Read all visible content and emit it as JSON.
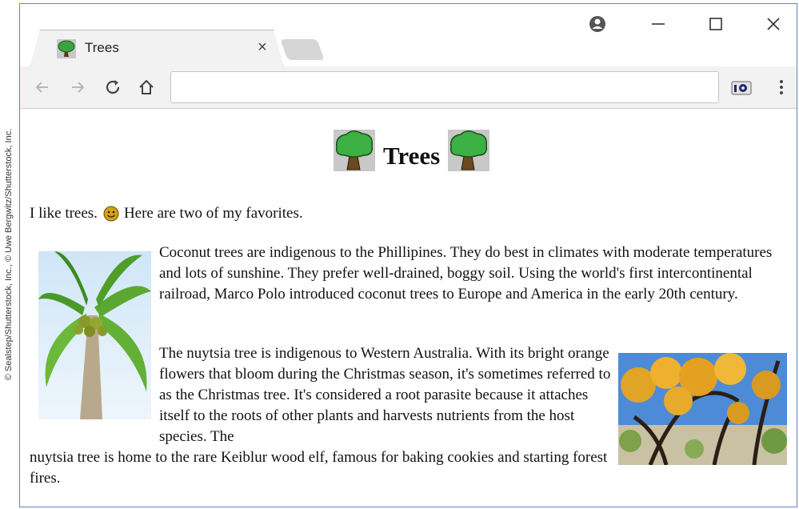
{
  "credit": "© Sealstep/Shutterstock, Inc., © Uwe Bergwitz/Shutterstock, Inc.",
  "browser": {
    "tab": {
      "title": "Trees",
      "close_glyph": "×",
      "icon": "tree-icon"
    },
    "window_controls": [
      "account-icon",
      "minimize-icon",
      "maximize-icon",
      "close-icon"
    ],
    "toolbar": {
      "buttons": [
        "back-arrow-icon",
        "forward-arrow-icon",
        "reload-icon",
        "home-icon"
      ],
      "address_value": "",
      "extension": "camera-extension-icon",
      "menu": "more-vertical-icon"
    }
  },
  "page": {
    "heading": "Trees",
    "intro_before": "I like trees.",
    "intro_after": "Here are two of my favorites.",
    "coconut_paragraph": "Coconut trees are indigenous to the Phillipines. They do best in climates with moderate temperatures and lots of sunshine. They prefer well-drained, boggy soil. Using the world's first intercontinental railroad, Marco Polo introduced coconut trees to Europe and America in the early 20th century.",
    "nuytsia_paragraph_part1": "The nuytsia tree is indigenous to Western Australia. With its bright orange flowers that bloom during the Christmas season, it's sometimes referred to as the Christmas tree. It's considered a root parasite because it attaches itself to the roots of other plants and harvests nutrients from the host species. The",
    "nuytsia_paragraph_part2": "nuytsia tree is home to the rare Keiblur wood elf, famous for baking cookies and starting forest fires."
  },
  "colors": {
    "window_border": "#5a86c9",
    "toolbar_bg": "#f2f2f2",
    "tree_green": "#2e8b2e"
  }
}
